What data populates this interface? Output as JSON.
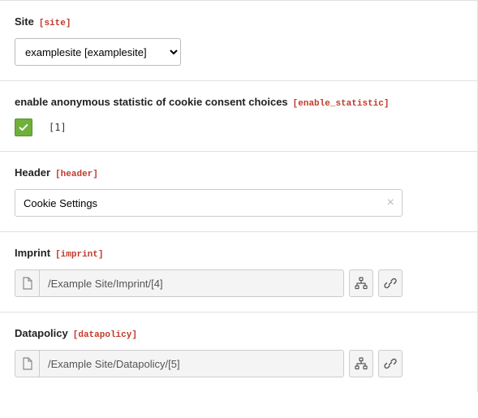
{
  "site": {
    "label": "Site",
    "key": "[site]",
    "selected": "examplesite [examplesite]"
  },
  "enable_statistic": {
    "label": "enable anonymous statistic of cookie consent choices",
    "key": "[enable_statistic]",
    "checked": true,
    "value_display": "[1]"
  },
  "header": {
    "label": "Header",
    "key": "[header]",
    "value": "Cookie Settings"
  },
  "imprint": {
    "label": "Imprint",
    "key": "[imprint]",
    "path": "/Example Site/Imprint/[4]"
  },
  "datapolicy": {
    "label": "Datapolicy",
    "key": "[datapolicy]",
    "path": "/Example Site/Datapolicy/[5]"
  }
}
